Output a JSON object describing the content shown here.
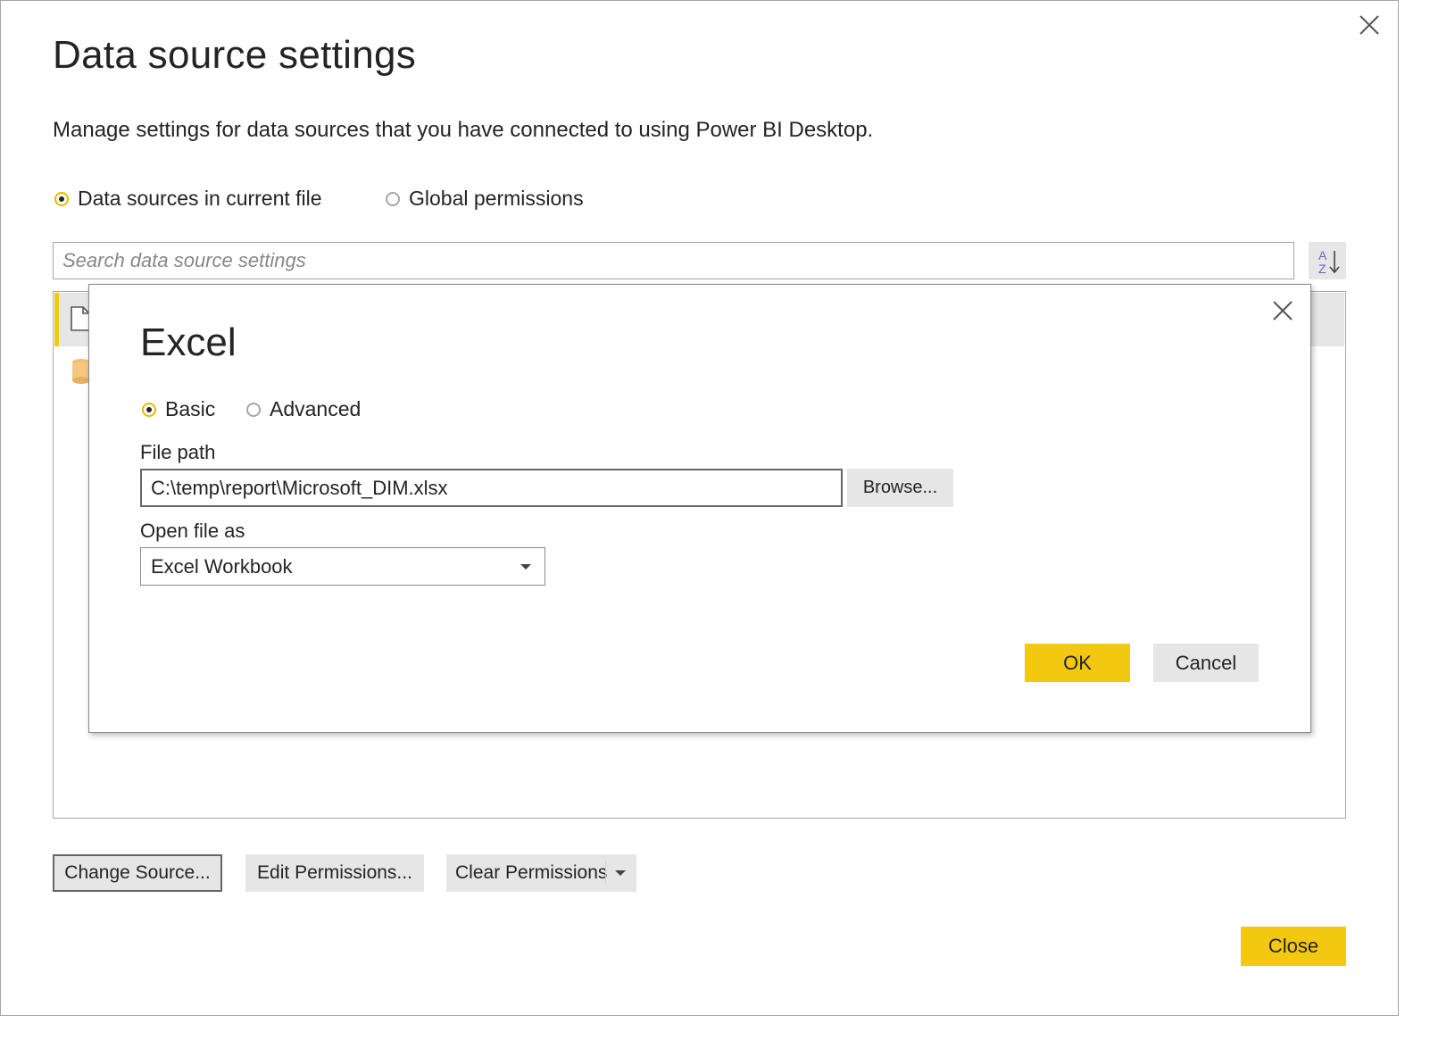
{
  "dialog": {
    "title": "Data source settings",
    "subtitle": "Manage settings for data sources that you have connected to using Power BI Desktop.",
    "scope_options": [
      {
        "label": "Data sources in current file",
        "selected": true
      },
      {
        "label": "Global permissions",
        "selected": false
      }
    ],
    "search": {
      "placeholder": "Search data source settings",
      "value": ""
    },
    "sort_icon": "sort-az-icon",
    "list_items": [
      {
        "icon": "file-icon",
        "selected": true
      },
      {
        "icon": "database-icon",
        "selected": false
      }
    ],
    "buttons": {
      "change_source": "Change Source...",
      "edit_permissions": "Edit Permissions...",
      "clear_permissions": "Clear Permissions",
      "close": "Close"
    }
  },
  "excel_dialog": {
    "title": "Excel",
    "mode_options": [
      {
        "label": "Basic",
        "selected": true
      },
      {
        "label": "Advanced",
        "selected": false
      }
    ],
    "file_path_label": "File path",
    "file_path_value": "C:\\temp\\report\\Microsoft_DIM.xlsx",
    "browse_label": "Browse...",
    "open_as_label": "Open file as",
    "open_as_value": "Excel Workbook",
    "ok_label": "OK",
    "cancel_label": "Cancel"
  },
  "colors": {
    "accent": "#f2c811",
    "button_bg": "#e6e6e6",
    "border": "#a6a6a6",
    "text": "#252423"
  }
}
